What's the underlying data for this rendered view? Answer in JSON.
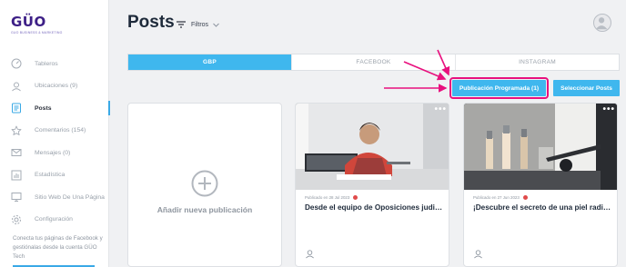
{
  "brand": {
    "name": "GÜO",
    "tagline": "GUO BUSINESS & MARKETING"
  },
  "sidebar": {
    "items": [
      {
        "label": "Tableros",
        "icon": "gauge-icon",
        "active": false
      },
      {
        "label": "Ubicaciones (9)",
        "icon": "location-icon",
        "active": false
      },
      {
        "label": "Posts",
        "icon": "document-icon",
        "active": true
      },
      {
        "label": "Comentarios (154)",
        "icon": "star-icon",
        "active": false
      },
      {
        "label": "Mensajes (0)",
        "icon": "envelope-icon",
        "active": false
      },
      {
        "label": "Estadística",
        "icon": "bar-chart-icon",
        "active": false
      },
      {
        "label": "Sitio Web De Una Página",
        "icon": "monitor-icon",
        "active": false
      },
      {
        "label": "Configuración",
        "icon": "gear-icon",
        "active": false
      }
    ],
    "note": "Conecta tus páginas de Facebook y gestiónalas desde la cuenta GÜO Tech"
  },
  "header": {
    "title": "Posts",
    "filter_label": "Filtros"
  },
  "tabs": [
    {
      "label": "GBP",
      "active": true
    },
    {
      "label": "FACEBOOK",
      "active": false
    },
    {
      "label": "INSTAGRAM",
      "active": false
    }
  ],
  "actions": {
    "scheduled_label": "Publicación Programada (1)",
    "select_label": "Seleccionar Posts"
  },
  "add_card": {
    "label": "Añadir nueva publicación"
  },
  "posts": [
    {
      "date": "Publicado en 28 Jul 2023",
      "title": "Desde el equipo de Oposiciones judiciales..."
    },
    {
      "date": "Publicado en 27 Jun 2023",
      "title": "¡Descubre el secreto de una piel radiante..."
    }
  ],
  "colors": {
    "accent": "#3fb7ee",
    "highlight": "#e8107e",
    "brand": "#3d1f86"
  }
}
